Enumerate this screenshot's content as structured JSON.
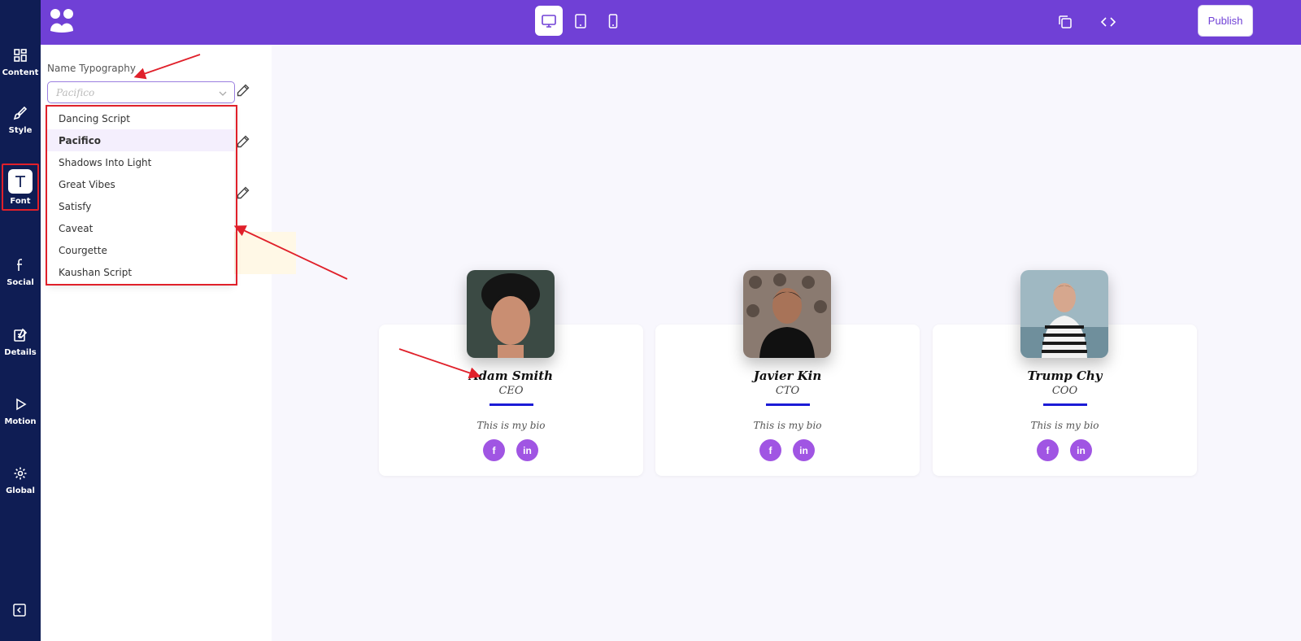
{
  "rail": {
    "items": [
      {
        "label": "Content",
        "icon": "grid-icon"
      },
      {
        "label": "Style",
        "icon": "brush-icon"
      },
      {
        "label": "Font",
        "icon": "text-icon"
      },
      {
        "label": "Social",
        "icon": "facebook-icon"
      },
      {
        "label": "Details",
        "icon": "edit-icon"
      },
      {
        "label": "Motion",
        "icon": "play-icon"
      },
      {
        "label": "Global",
        "icon": "gear-icon"
      }
    ],
    "active": "Font"
  },
  "topbar": {
    "publish_label": "Publish",
    "active_device": "desktop"
  },
  "panel": {
    "field_label": "Name Typography",
    "selected_value": "Pacifico",
    "font_options": [
      "Dancing Script",
      "Pacifico",
      "Shadows Into Light",
      "Great Vibes",
      "Satisfy",
      "Caveat",
      "Courgette",
      "Kaushan Script"
    ]
  },
  "cards": [
    {
      "name": "Adam Smith",
      "role": "CEO",
      "bio": "This is my bio"
    },
    {
      "name": "Javier Kin",
      "role": "CTO",
      "bio": "This is my bio"
    },
    {
      "name": "Trump Chy",
      "role": "COO",
      "bio": "This is my bio"
    }
  ],
  "colors": {
    "rail": "#0f1d54",
    "topbar": "#7040d6",
    "accent": "#a055e3",
    "divider": "#1b1bd6",
    "annotation": "#e0202a"
  }
}
